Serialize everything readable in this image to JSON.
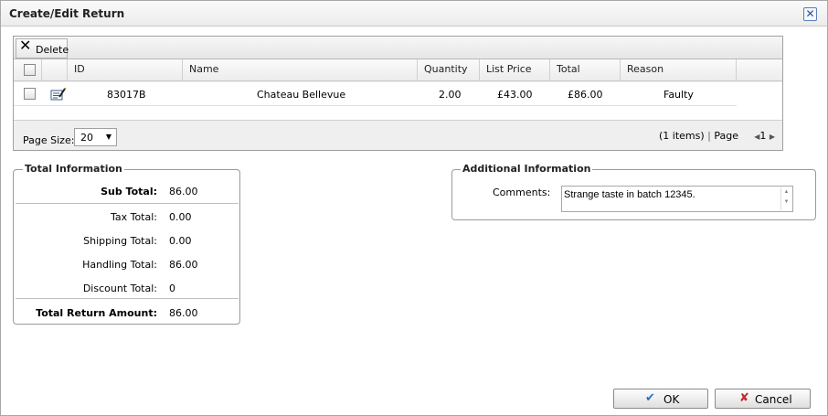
{
  "window": {
    "title": "Create/Edit Return",
    "close_glyph": "✕"
  },
  "toolbar": {
    "delete_label": "Delete",
    "delete_icon": "delete-x-icon"
  },
  "grid": {
    "columns": [
      "ID",
      "Name",
      "Quantity",
      "List Price",
      "Total",
      "Reason"
    ],
    "rows": [
      {
        "id": "83017B",
        "name": "Chateau Bellevue",
        "quantity": "2.00",
        "list_price": "£43.00",
        "total": "£86.00",
        "reason": "Faulty"
      }
    ],
    "pager": {
      "page_size_label": "Page Size:",
      "page_size_value": "20",
      "items": "(1 items)",
      "page_label": "Page",
      "page_number": "1"
    }
  },
  "totals": {
    "legend": "Total Information",
    "sub_total_label": "Sub Total:",
    "sub_total": "86.00",
    "tax_total_label": "Tax Total:",
    "tax_total": "0.00",
    "shipping_total_label": "Shipping Total:",
    "shipping_total": "0.00",
    "handling_total_label": "Handling Total:",
    "handling_total": "86.00",
    "discount_total_label": "Discount Total:",
    "discount_total": "0",
    "return_amount_label": "Total Return Amount:",
    "return_amount": "86.00"
  },
  "additional": {
    "legend": "Additional Information",
    "comments_label": "Comments:",
    "comments_value": "Strange taste in batch 12345."
  },
  "buttons": {
    "ok_label": "OK",
    "cancel_label": "Cancel"
  },
  "colors": {
    "ok_check": "#2b6cc4",
    "cancel_x": "#c0282d"
  }
}
